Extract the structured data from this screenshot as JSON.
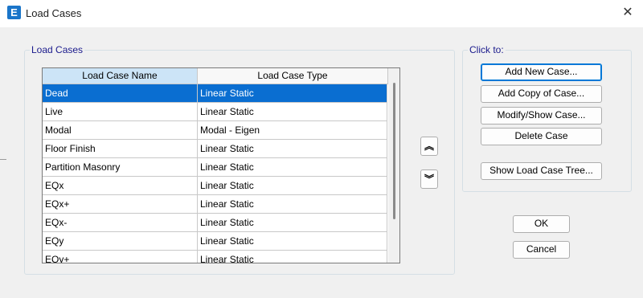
{
  "window": {
    "title": "Load Cases",
    "app_icon_letter": "E",
    "close_glyph": "✕"
  },
  "load_cases_group": {
    "legend": "Load Cases",
    "columns": [
      "Load Case Name",
      "Load Case Type"
    ],
    "rows": [
      {
        "name": "Dead",
        "type": "Linear Static",
        "selected": true
      },
      {
        "name": "Live",
        "type": "Linear Static"
      },
      {
        "name": "Modal",
        "type": "Modal - Eigen"
      },
      {
        "name": "Floor Finish",
        "type": "Linear Static"
      },
      {
        "name": "Partition Masonry",
        "type": "Linear Static"
      },
      {
        "name": "EQx",
        "type": "Linear Static"
      },
      {
        "name": "EQx+",
        "type": "Linear Static"
      },
      {
        "name": "EQx-",
        "type": "Linear Static"
      },
      {
        "name": "EQy",
        "type": "Linear Static"
      },
      {
        "name": "EQy+",
        "type": "Linear Static"
      }
    ]
  },
  "move_buttons": {
    "up_glyph": "︽",
    "down_glyph": "︾"
  },
  "click_to_group": {
    "legend": "Click to:",
    "add_new_case": "Add New Case...",
    "add_copy_of_case": "Add Copy of Case...",
    "modify_show_case": "Modify/Show Case...",
    "delete_case": "Delete Case",
    "show_load_case_tree": "Show Load Case Tree..."
  },
  "footer": {
    "ok": "OK",
    "cancel": "Cancel"
  },
  "colors": {
    "selection": "#0a6ed1",
    "header_highlight": "#cce4f7",
    "focus_border": "#0078d7",
    "app_icon": "#1a75c9"
  },
  "icons": {
    "app": "etabs-app-icon",
    "close": "close-icon",
    "move_up": "double-chevron-up-icon",
    "move_down": "double-chevron-down-icon"
  }
}
